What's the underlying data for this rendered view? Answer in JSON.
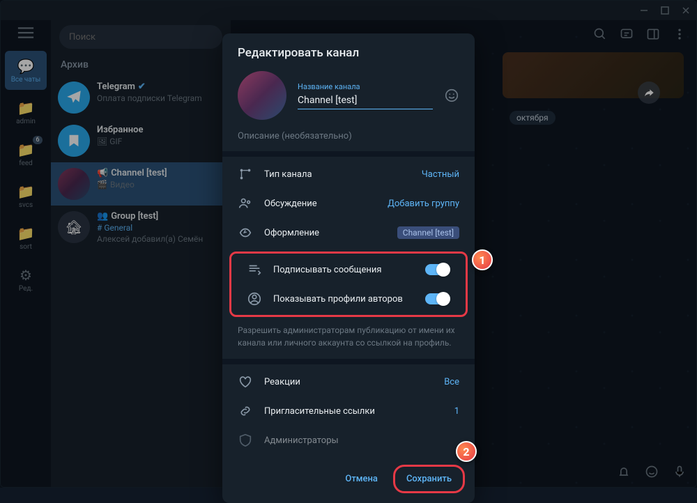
{
  "search": {
    "placeholder": "Поиск"
  },
  "folders": [
    {
      "id": "all",
      "label": "Все чаты",
      "active": true
    },
    {
      "id": "admin",
      "label": "admin"
    },
    {
      "id": "feed",
      "label": "feed",
      "badge": "6"
    },
    {
      "id": "svcs",
      "label": "svcs"
    },
    {
      "id": "sort",
      "label": "sort"
    },
    {
      "id": "edit",
      "label": "Ред."
    }
  ],
  "archive_label": "Архив",
  "chats": [
    {
      "title": "Telegram",
      "verified": true,
      "preview": "Оплата подписки Telegram",
      "avatar_bg": "#2aabee"
    },
    {
      "title": "Избранное",
      "prefix": "🖼 GIF",
      "preview": "",
      "avatar_bg": "#2aabee"
    },
    {
      "title": "Channel [test]",
      "icon": "📢",
      "prefix": "🎬",
      "preview": "Видео",
      "selected": true,
      "avatar_grad": true
    },
    {
      "title": "Group [test]",
      "icon": "👥",
      "sub": "# General",
      "preview": "Алексей добавил(а) Семён",
      "avatar_bg": "#3a4a5e"
    }
  ],
  "date_chip": "октября",
  "modal": {
    "title": "Редактировать канал",
    "name_label": "Название канала",
    "name_value": "Channel [test]",
    "description_placeholder": "Описание (необязательно)",
    "settings": {
      "type": {
        "label": "Тип канала",
        "value": "Частный"
      },
      "discussion": {
        "label": "Обсуждение",
        "value": "Добавить группу"
      },
      "appearance": {
        "label": "Оформление",
        "badge": "Channel [test]"
      },
      "sign": {
        "label": "Подписывать сообщения"
      },
      "profiles": {
        "label": "Показывать профили авторов"
      },
      "reactions": {
        "label": "Реакции",
        "value": "Все"
      },
      "invites": {
        "label": "Пригласительные ссылки",
        "value": "1"
      },
      "admins": {
        "label": "Администраторы"
      }
    },
    "help": "Разрешить администраторам публикацию от имени их канала или личного аккаунта со ссылкой на профиль.",
    "cancel": "Отмена",
    "save": "Сохранить"
  },
  "callouts": {
    "one": "1",
    "two": "2"
  }
}
